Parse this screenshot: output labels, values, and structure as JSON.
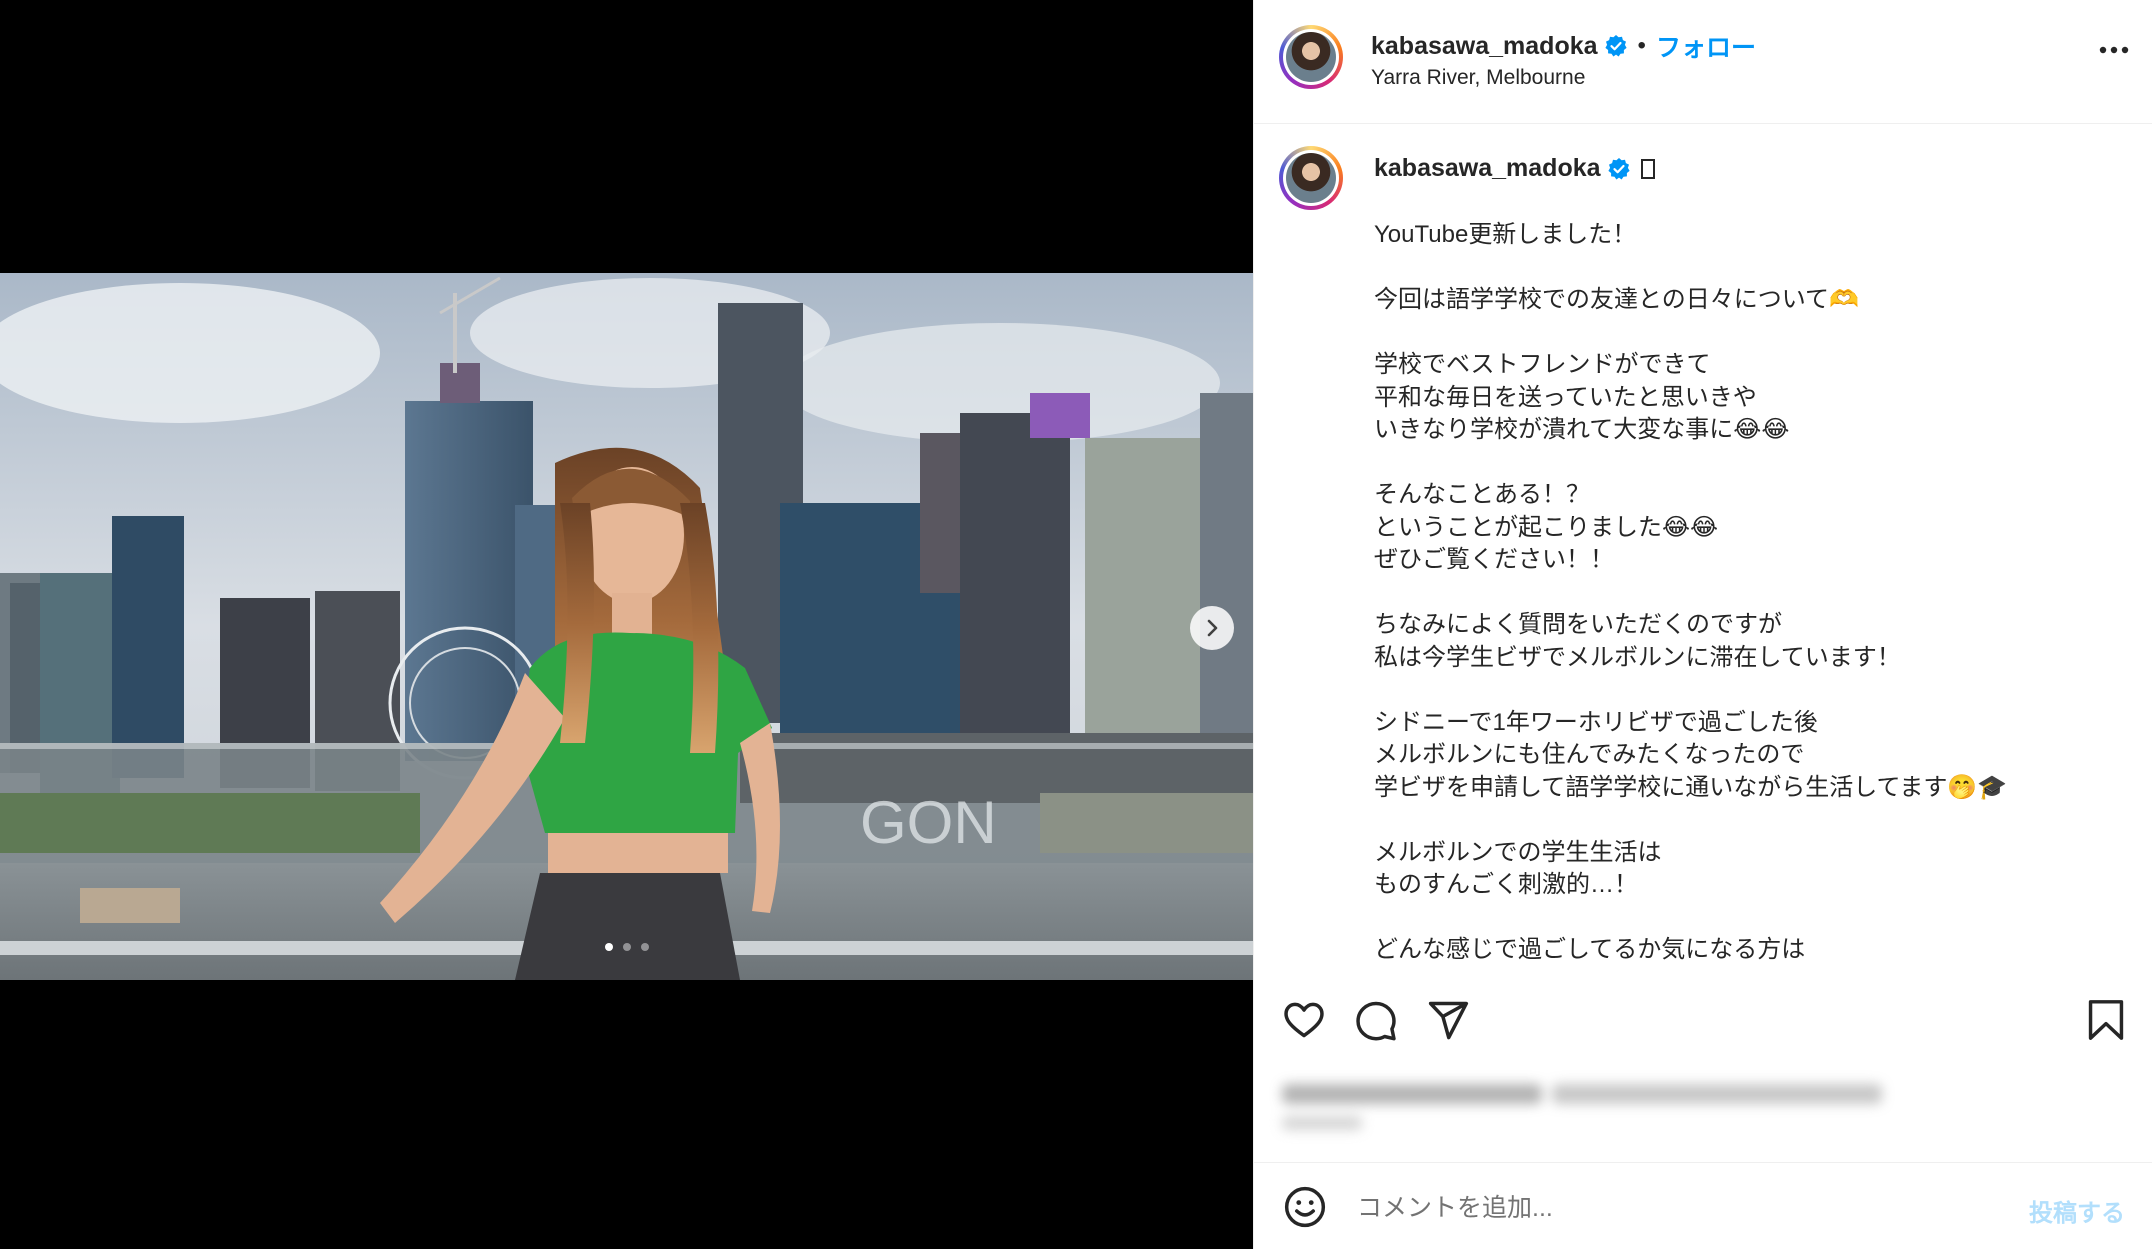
{
  "post": {
    "username": "kabasawa_madoka",
    "separator": "•",
    "follow_label": "フォロー",
    "location": "Yarra River, Melbourne",
    "caption_username": "kabasawa_madoka",
    "caption_lines": [
      "YouTube更新しました！",
      "",
      "今回は語学学校での友達との日々について🫶",
      "",
      "学校でベストフレンドができて",
      "平和な毎日を送っていたと思いきや",
      "いきなり学校が潰れて大変な事に😂😂",
      "",
      "そんなことある！？",
      "ということが起こりました😂😂",
      "ぜひご覧ください！！",
      "",
      "ちなみによく質問をいただくのですが",
      "私は今学生ビザでメルボルンに滞在しています！",
      "",
      "シドニーで1年ワーホリビザで過ごした後",
      "メルボルンにも住んでみたくなったので",
      "学ビザを申請して語学学校に通いながら生活してます🤭🎓",
      "",
      "メルボルンでの学生生活は",
      "ものすんごく刺激的…！",
      "",
      "どんな感じで過ごしてるか気になる方は"
    ]
  },
  "media": {
    "slides": 3,
    "active_slide": 0
  },
  "comment": {
    "placeholder": "コメントを追加...",
    "post_label": "投稿する"
  },
  "colors": {
    "accent": "#0095f6",
    "verified": "#0095f6",
    "post_disabled": "#b2dffc"
  },
  "icons": [
    "more-icon",
    "verified-icon",
    "heart-icon",
    "comment-icon",
    "share-icon",
    "bookmark-icon",
    "emoji-icon",
    "chevron-right-icon"
  ]
}
